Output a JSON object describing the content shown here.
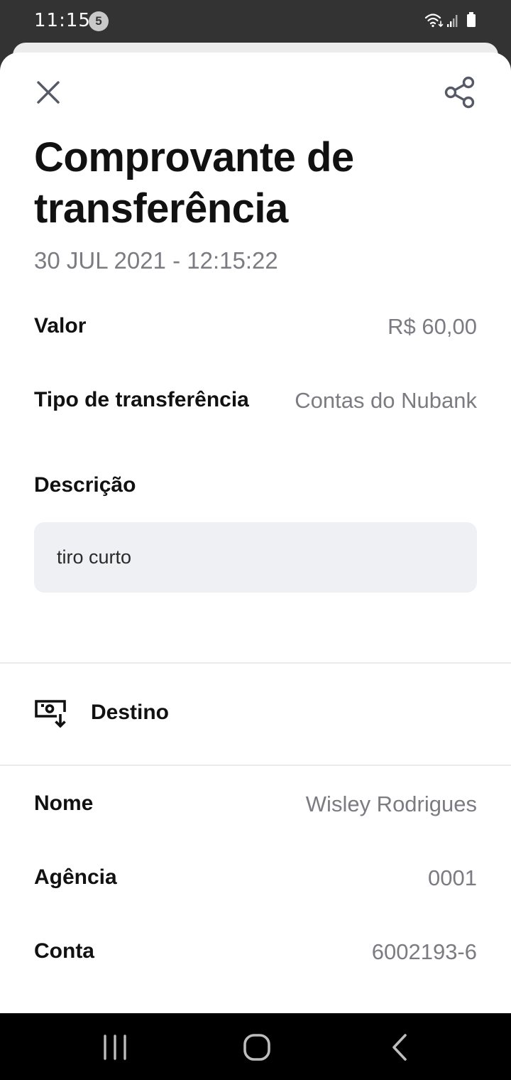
{
  "status_bar": {
    "time": "11:15",
    "notification_count": "5",
    "icons": [
      "wifi-icon",
      "signal-icon",
      "battery-icon"
    ]
  },
  "header": {
    "title": "Comprovante de transferência",
    "datetime": "30 JUL 2021 - 12:15:22",
    "close_icon": "close-icon",
    "share_icon": "share-icon"
  },
  "details": [
    {
      "label": "Valor",
      "value": "R$ 60,00"
    },
    {
      "label": "Tipo de transferência",
      "value": "Contas do Nubank"
    }
  ],
  "description": {
    "label": "Descrição",
    "text": "tiro curto"
  },
  "destination": {
    "title": "Destino",
    "icon": "money-receive-icon",
    "rows": [
      {
        "label": "Nome",
        "value": "Wisley Rodrigues"
      },
      {
        "label": "Agência",
        "value": "0001"
      },
      {
        "label": "Conta",
        "value": "6002193-6"
      }
    ]
  },
  "nav_bar": {
    "icons": [
      "recent-apps-icon",
      "home-icon",
      "back-icon"
    ]
  },
  "colors": {
    "status_bar_bg": "#333333",
    "title_text": "#111111",
    "secondary_text": "#7b7b82",
    "description_box_bg": "#eff0f3",
    "nav_bar_bg": "#000000"
  }
}
